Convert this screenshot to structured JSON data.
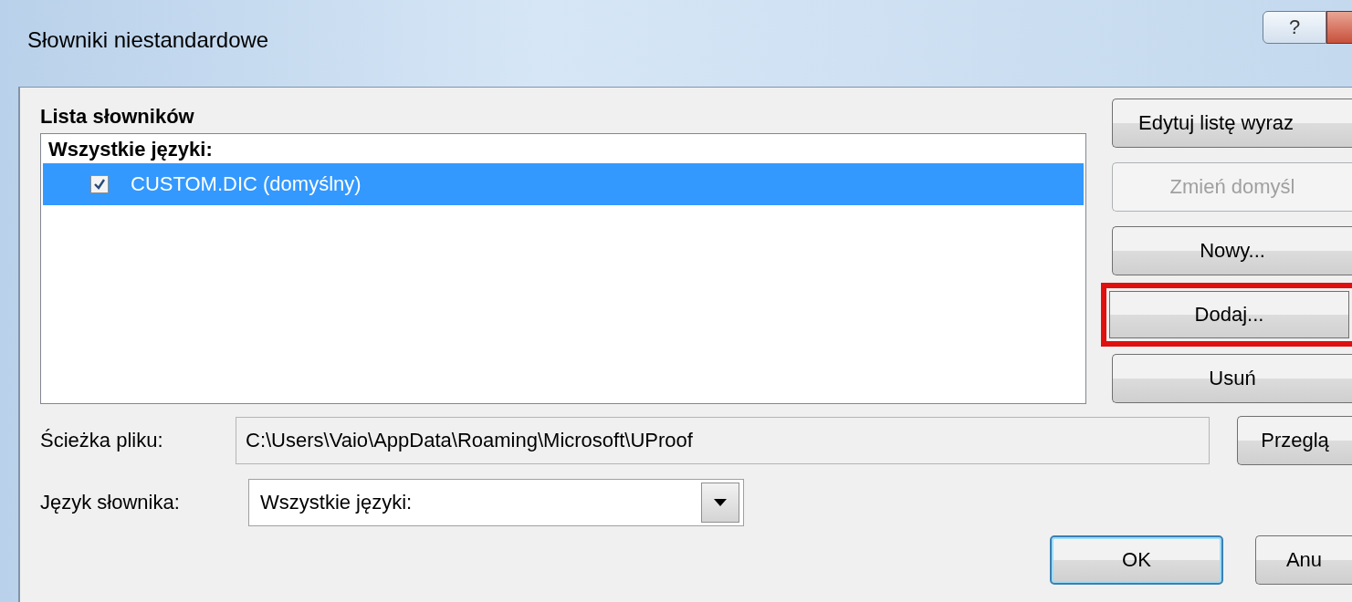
{
  "window": {
    "title": "Słowniki niestandardowe",
    "help_button": "?"
  },
  "dictionary_list": {
    "label": "Lista słowników",
    "group": "Wszystkie języki:",
    "items": [
      {
        "label": "CUSTOM.DIC (domyślny)",
        "checked": true,
        "selected": true
      }
    ]
  },
  "side_buttons": [
    {
      "label": "Edytuj listę wyraz",
      "disabled": false,
      "highlighted": false
    },
    {
      "label": "Zmień domyśl",
      "disabled": true,
      "highlighted": false
    },
    {
      "label": "Nowy...",
      "disabled": false,
      "highlighted": false
    },
    {
      "label": "Dodaj...",
      "disabled": false,
      "highlighted": true
    },
    {
      "label": "Usuń",
      "disabled": false,
      "highlighted": false
    }
  ],
  "file_path": {
    "label": "Ścieżka pliku:",
    "value": "C:\\Users\\Vaio\\AppData\\Roaming\\Microsoft\\UProof",
    "browse_button": "Przeglą"
  },
  "language": {
    "label": "Język słownika:",
    "value": "Wszystkie języki:"
  },
  "buttons": [
    {
      "label": "OK",
      "default": true
    },
    {
      "label": "Anu",
      "default": false
    }
  ]
}
